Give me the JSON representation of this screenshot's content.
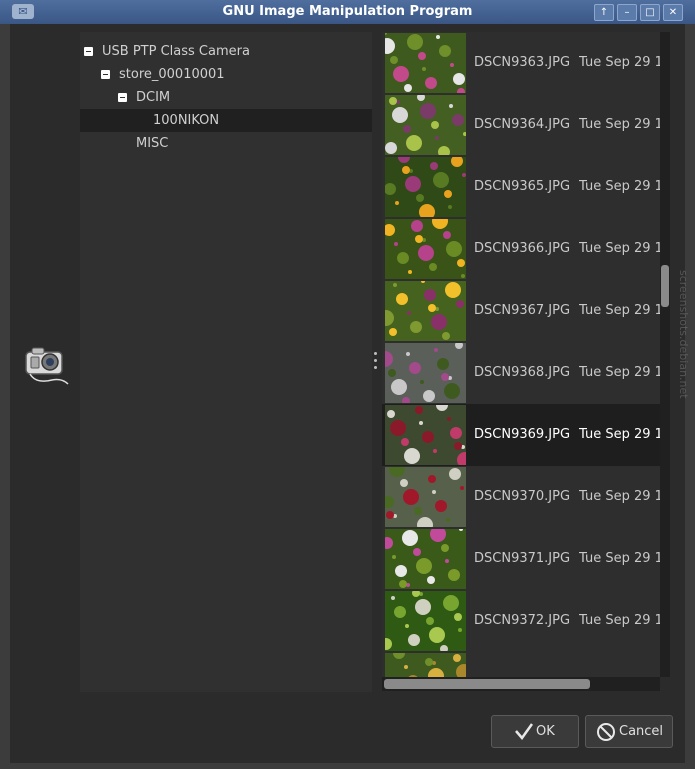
{
  "window": {
    "title": "GNU Image Manipulation Program",
    "buttons": [
      "↑",
      "–",
      "□",
      "✕"
    ]
  },
  "tree": {
    "items": [
      {
        "label": "USB PTP Class Camera",
        "expanded": true
      },
      {
        "label": "store_00010001",
        "expanded": true
      },
      {
        "label": "DCIM",
        "expanded": true
      },
      {
        "label": "100NIKON",
        "selected": true
      },
      {
        "label": "MISC"
      }
    ]
  },
  "files": [
    {
      "name": "DSCN9363.JPG",
      "date": "Tue Sep 29 1"
    },
    {
      "name": "DSCN9364.JPG",
      "date": "Tue Sep 29 1"
    },
    {
      "name": "DSCN9365.JPG",
      "date": "Tue Sep 29 1"
    },
    {
      "name": "DSCN9366.JPG",
      "date": "Tue Sep 29 1"
    },
    {
      "name": "DSCN9367.JPG",
      "date": "Tue Sep 29 1"
    },
    {
      "name": "DSCN9368.JPG",
      "date": "Tue Sep 29 1"
    },
    {
      "name": "DSCN9369.JPG",
      "date": "Tue Sep 29 1",
      "selected": true
    },
    {
      "name": "DSCN9370.JPG",
      "date": "Tue Sep 29 1"
    },
    {
      "name": "DSCN9371.JPG",
      "date": "Tue Sep 29 1"
    },
    {
      "name": "DSCN9372.JPG",
      "date": "Tue Sep 29 1"
    },
    {
      "name": "",
      "date": ""
    }
  ],
  "buttons": {
    "ok_label": "OK",
    "cancel_label": "Cancel"
  },
  "watermark": "screenshots.debian.net",
  "colors": {
    "titlebar": "#3a5685",
    "background": "#2b2b2b",
    "selection": "#1e1e1e"
  }
}
